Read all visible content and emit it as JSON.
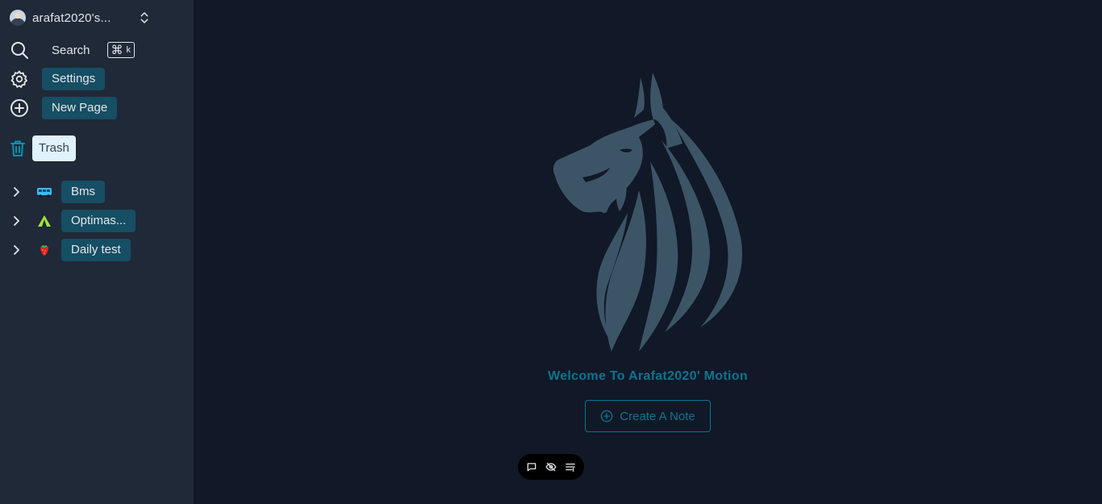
{
  "sidebar": {
    "user": {
      "name": "arafat2020's..."
    },
    "search": {
      "label": "Search",
      "shortcut_symbol": "⌘",
      "shortcut_key": "k"
    },
    "settings": {
      "label": "Settings"
    },
    "new_page": {
      "label": "New Page"
    },
    "trash": {
      "label": "Trash"
    },
    "pages": [
      {
        "label": "Bms",
        "icon": "bus-icon"
      },
      {
        "label": "Optimas...",
        "icon": "tent-icon"
      },
      {
        "label": "Daily test",
        "icon": "strawberry-icon"
      }
    ]
  },
  "main": {
    "welcome": "Welcome To Arafat2020' Motion",
    "create_button": "Create A Note"
  },
  "colors": {
    "sidebar_bg": "#1f2937",
    "main_bg": "#111827",
    "pill_bg": "#164e63",
    "accent": "#0e7490",
    "logo": "#3c5566"
  }
}
